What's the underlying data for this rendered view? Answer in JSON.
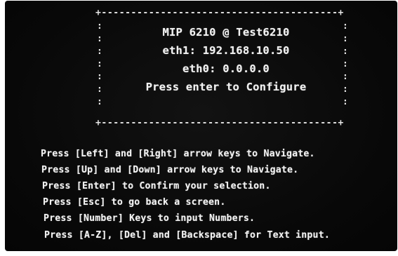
{
  "status_box": {
    "device_line": "MIP 6210 @ Test6210",
    "eth1_line": "eth1: 192.168.10.50",
    "eth0_line": "eth0: 0.0.0.0",
    "prompt_line": "Press enter to Configure"
  },
  "instructions": {
    "lines": [
      "Press [Left] and [Right] arrow keys to Navigate.",
      "Press [Up] and [Down] arrow keys to Navigate.",
      "Press [Enter] to Confirm your selection.",
      "Press [Esc] to go back a screen.",
      "Press [Number] Keys to input Numbers.",
      "Press [A-Z], [Del] and [Backspace] for Text input."
    ]
  },
  "colors": {
    "screen_background": "#0a0a0a",
    "text": "#f2f2f2"
  }
}
